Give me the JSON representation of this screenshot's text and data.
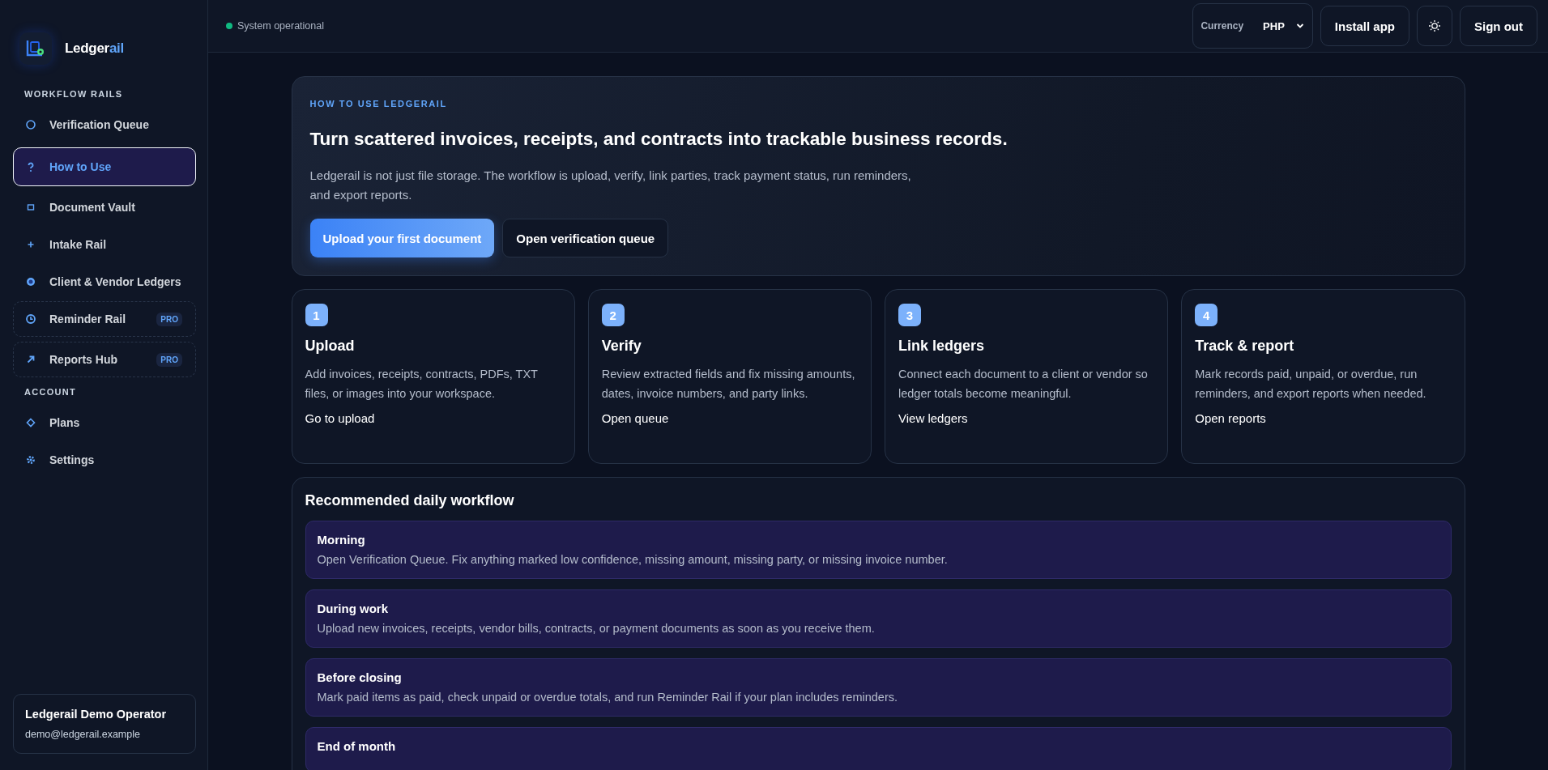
{
  "sidebar": {
    "brand": {
      "main": "Ledger",
      "accent": "ail"
    },
    "sections": [
      {
        "title": "WORKFLOW RAILS",
        "items": [
          {
            "label": "Verification Queue",
            "selected": false
          },
          {
            "label": "How to Use",
            "selected": true
          },
          {
            "label": "Document Vault",
            "selected": false
          },
          {
            "label": "Intake Rail",
            "selected": false
          },
          {
            "label": "Client & Vendor Ledgers",
            "selected": false
          },
          {
            "label": "Reminder Rail",
            "selected": false,
            "badge": "PRO"
          },
          {
            "label": "Reports Hub",
            "selected": false,
            "badge": "PRO"
          }
        ]
      },
      {
        "title": "ACCOUNT",
        "items": [
          {
            "label": "Plans",
            "selected": false
          },
          {
            "label": "Settings",
            "selected": false
          }
        ]
      }
    ],
    "user": {
      "name": "Ledgerail Demo Operator",
      "email": "demo@ledgerail.example"
    }
  },
  "topbar": {
    "status": "System operational",
    "currency": {
      "label": "Currency",
      "value": "PHP"
    },
    "buttons": [
      "Install app",
      "Sign out"
    ]
  },
  "hero": {
    "eyebrow": "HOW TO USE LEDGERAIL",
    "title": "Turn scattered invoices, receipts, and contracts into trackable business records.",
    "body": "Ledgerail is not just file storage. The workflow is upload, verify, link parties, track payment status, run reminders, and export reports.",
    "primary": "Upload your first document",
    "secondary": "Open verification queue"
  },
  "steps": [
    {
      "number": "1",
      "title": "Upload",
      "body": "Add invoices, receipts, contracts, PDFs, TXT files, or images into your workspace.",
      "link": "Go to upload"
    },
    {
      "number": "2",
      "title": "Verify",
      "body": "Review extracted fields and fix missing amounts, dates, invoice numbers, and party links.",
      "link": "Open queue"
    },
    {
      "number": "3",
      "title": "Link ledgers",
      "body": "Connect each document to a client or vendor so ledger totals become meaningful.",
      "link": "View ledgers"
    },
    {
      "number": "4",
      "title": "Track & report",
      "body": "Mark records paid, unpaid, or overdue, run reminders, and export reports when needed.",
      "link": "Open reports"
    }
  ],
  "workflow": {
    "title": "Recommended daily workflow",
    "items": [
      {
        "title": "Morning",
        "body": "Open Verification Queue. Fix anything marked low confidence, missing amount, missing party, or missing invoice number."
      },
      {
        "title": "During work",
        "body": "Upload new invoices, receipts, vendor bills, contracts, or payment documents as soon as you receive them."
      },
      {
        "title": "Before closing",
        "body": "Mark paid items as paid, check unpaid or overdue totals, and run Reminder Rail if your plan includes reminders."
      },
      {
        "title": "End of month"
      }
    ]
  }
}
